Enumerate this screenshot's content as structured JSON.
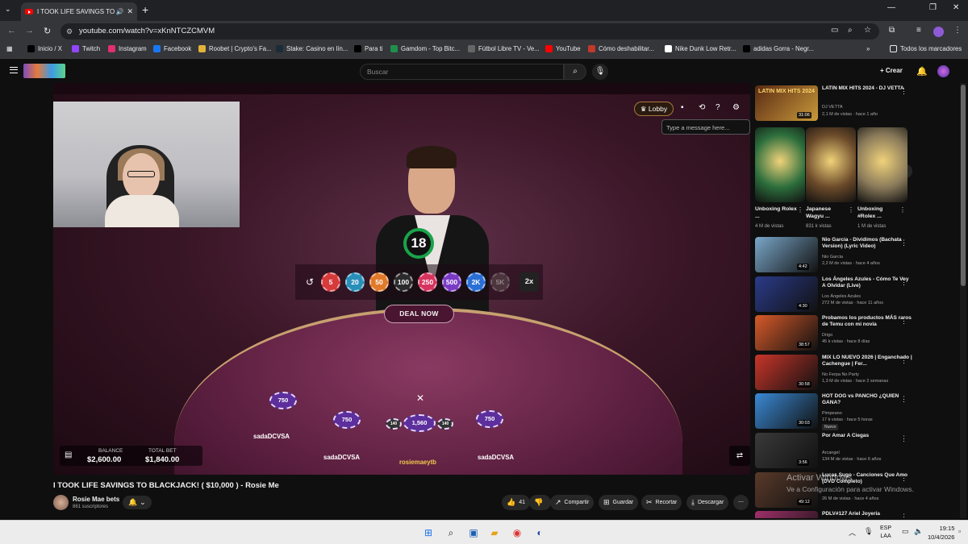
{
  "browser": {
    "tab_title": "I TOOK LIFE SAVINGS TO BL",
    "url": "youtube.com/watch?v=xKnNTCZCMVM",
    "bookmarks": [
      {
        "label": "Inicio / X",
        "icon": "x-logo-icon",
        "color": "#000000"
      },
      {
        "label": "Twitch",
        "icon": "twitch-icon",
        "color": "#9146ff"
      },
      {
        "label": "Instagram",
        "icon": "instagram-icon",
        "color": "#e1306c"
      },
      {
        "label": "Facebook",
        "icon": "facebook-icon",
        "color": "#1877f2"
      },
      {
        "label": "Roobet | Crypto's Fa...",
        "icon": "roobet-icon",
        "color": "#e2b23a"
      },
      {
        "label": "Stake: Casino en lín...",
        "icon": "stake-icon",
        "color": "#1a2c38"
      },
      {
        "label": "Para ti",
        "icon": "x-logo-icon",
        "color": "#000000"
      },
      {
        "label": "Gamdom - Top Bitc...",
        "icon": "gamdom-icon",
        "color": "#1f8f4e"
      },
      {
        "label": "Fútbol Libre TV - Ve...",
        "icon": "globe-icon",
        "color": "#666666"
      },
      {
        "label": "YouTube",
        "icon": "youtube-icon",
        "color": "#ff0000"
      },
      {
        "label": "Cómo deshabilitar...",
        "icon": "info-icon",
        "color": "#c0392b"
      },
      {
        "label": "Nike Dunk Low Retr...",
        "icon": "nike-icon",
        "color": "#ffffff"
      },
      {
        "label": "adidas Gorra - Negr...",
        "icon": "adidas-icon",
        "color": "#000000"
      }
    ],
    "all_bookmarks": "Todos los marcadores"
  },
  "youtube": {
    "search_placeholder": "Buscar",
    "create_label": "Crear"
  },
  "game": {
    "timer": "18",
    "chips": [
      {
        "label": "5",
        "color": "#d63a3a"
      },
      {
        "label": "20",
        "color": "#2a8fb8"
      },
      {
        "label": "50",
        "color": "#e07a2a"
      },
      {
        "label": "100",
        "color": "#2b2b2b"
      },
      {
        "label": "250",
        "color": "#d6345e"
      },
      {
        "label": "500",
        "color": "#7a3bc4"
      },
      {
        "label": "2K",
        "color": "#2a6fd6"
      },
      {
        "label": "5K",
        "color": "#6b5a5a"
      }
    ],
    "multiplier": "2x",
    "deal_now": "DEAL NOW",
    "lobby": "Lobby",
    "message_placeholder": "Type a message here...",
    "table_chips": [
      "750",
      "750",
      "1,560",
      "750"
    ],
    "side_chips": [
      "140",
      "140"
    ],
    "players": [
      "sadaDCVSA",
      "sadaDCVSA",
      "rosiemaeytb",
      "sadaDCVSA"
    ],
    "balance_label": "BALANCE",
    "balance_value": "$2,600.00",
    "total_bet_label": "TOTAL BET",
    "total_bet_value": "$1,840.00"
  },
  "video": {
    "title": "I TOOK LIFE SAVINGS TO BLACKJACK! ( $10,000 ) - Rosie Me",
    "channel": "Rosie Mae bets",
    "subscribers": "861 suscriptores",
    "likes": "41",
    "share": "Compartir",
    "save": "Guardar",
    "clip": "Recortar",
    "download": "Descargar"
  },
  "sidebar": {
    "top": {
      "title": "LATIN MIX HITS 2024 - DJ VETTA",
      "channel": "DJ VETTA",
      "meta": "2,1 M de vistas · hace 1 año",
      "duration": "31:06",
      "thumb_text": "LATIN MIX HITS 2024"
    },
    "shorts": [
      {
        "title": "Unboxing Rolex ...",
        "views": "4 M de vistas",
        "color": "#2c6e3c"
      },
      {
        "title": "Japanese Wagyu ...",
        "views": "831 k vistas",
        "color": "#6b4a2a"
      },
      {
        "title": "Unboxing #Rolex ...",
        "views": "1 M de vistas",
        "color": "#8a7a5a"
      }
    ],
    "videos": [
      {
        "title": "Nio Garcia - Dividimos (Bachata Version) (Lyric Video)",
        "channel": "Nio Garcia",
        "meta": "2,2 M de vistas · hace 4 años",
        "duration": "4:42",
        "color": "#7aa7c9"
      },
      {
        "title": "Los Ángeles Azules - Cómo Te Voy A Olvidar (Live)",
        "channel": "Los Ángeles Azules",
        "meta": "272 M de vistas · hace 11 años",
        "duration": "4:30",
        "color": "#2a3b8a"
      },
      {
        "title": "Probamos los productos MÁS raros de Temu con mi novia",
        "channel": "Drigo",
        "meta": "45 k vistas · hace 8 días",
        "duration": "38:57",
        "color": "#d85a2a"
      },
      {
        "title": "MIX LO NUEVO 2026 | Enganchado | Cachengue | Fer...",
        "channel": "No Ferpa No Party",
        "meta": "1,3 M de vistas · hace 2 semanas",
        "duration": "30:58",
        "color": "#c9352a"
      },
      {
        "title": "HOT DOG vs PANCHO ¿QUIEN GANA?",
        "channel": "Pimpeano",
        "meta": "17 k vistas · hace 5 horas",
        "duration": "30:03",
        "color": "#3a8ad6",
        "badge": "Nuevo"
      },
      {
        "title": "Por Amar A Ciegas",
        "channel": "Arcangel",
        "meta": "134 M de vistas · hace 6 años",
        "duration": "3:56",
        "color": "#3a3a3a"
      },
      {
        "title": "Lucas Sugo - Canciones Que Amo (DVD Completo)",
        "channel": "",
        "meta": "26 M de vistas · hace 4 años",
        "duration": "49:12",
        "color": "#5a3a2a"
      },
      {
        "title": "PDLV#127 Ariel Joyeria",
        "channel": "",
        "meta": "",
        "duration": "",
        "color": "#a0306a"
      }
    ]
  },
  "watermark": {
    "line1": "Activar Windows",
    "line2": "Ve a Configuración para activar Windows."
  },
  "taskbar": {
    "lang1": "ESP",
    "lang2": "LAA",
    "time": "19:15",
    "date": "10/4/2026"
  }
}
